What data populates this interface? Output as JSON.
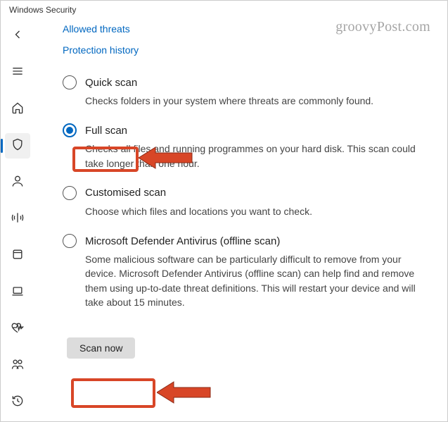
{
  "window": {
    "title": "Windows Security"
  },
  "watermark": "groovyPost.com",
  "sidebar": {
    "items": [
      {
        "name": "back",
        "icon": "arrow-left"
      },
      {
        "name": "menu",
        "icon": "hamburger"
      },
      {
        "name": "home",
        "icon": "home"
      },
      {
        "name": "virus-protection",
        "icon": "shield",
        "selected": true
      },
      {
        "name": "account-protection",
        "icon": "person"
      },
      {
        "name": "firewall",
        "icon": "wifi"
      },
      {
        "name": "app-browser",
        "icon": "app"
      },
      {
        "name": "device-security",
        "icon": "laptop"
      },
      {
        "name": "device-performance",
        "icon": "heart"
      },
      {
        "name": "family-options",
        "icon": "family"
      },
      {
        "name": "protection-history",
        "icon": "history"
      }
    ]
  },
  "links": {
    "allowed_threats": "Allowed threats",
    "protection_history": "Protection history"
  },
  "scan_options": [
    {
      "id": "quick",
      "label": "Quick scan",
      "desc": "Checks folders in your system where threats are commonly found.",
      "checked": false
    },
    {
      "id": "full",
      "label": "Full scan",
      "desc": "Checks all files and running programmes on your hard disk. This scan could take longer than one hour.",
      "checked": true
    },
    {
      "id": "custom",
      "label": "Customised scan",
      "desc": "Choose which files and locations you want to check.",
      "checked": false
    },
    {
      "id": "offline",
      "label": "Microsoft Defender Antivirus (offline scan)",
      "desc": "Some malicious software can be particularly difficult to remove from your device. Microsoft Defender Antivirus (offline scan) can help find and remove them using up-to-date threat definitions. This will restart your device and will take about 15 minutes.",
      "checked": false
    }
  ],
  "button": {
    "scan_now": "Scan now"
  },
  "annotations": {
    "highlight_color": "#d84627",
    "highlights": [
      "full-scan-option",
      "scan-now-button"
    ]
  }
}
